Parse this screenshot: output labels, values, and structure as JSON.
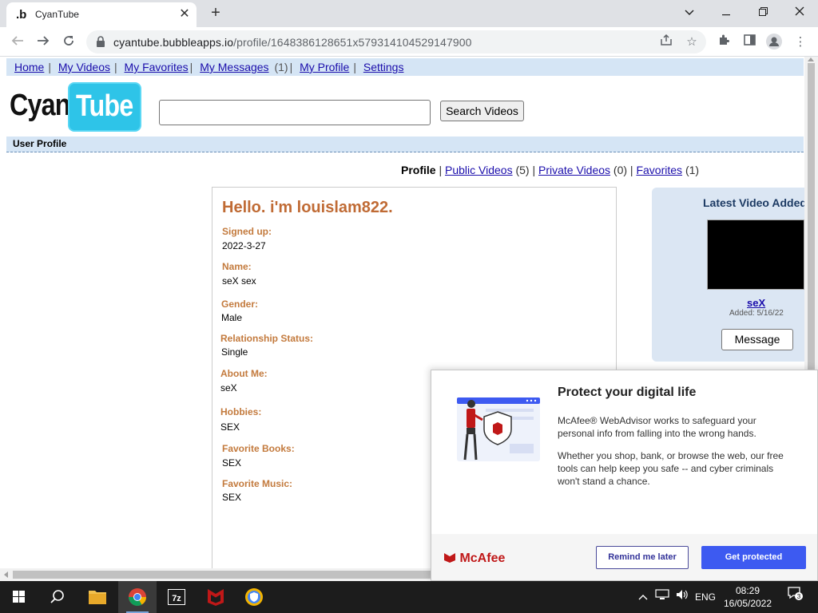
{
  "browser": {
    "tab_title": "CyanTube",
    "tab_favicon": ".b",
    "url_host": "cyantube.bubbleapps.io",
    "url_path": "/profile/1648386128651x579314104529147900"
  },
  "site": {
    "nav": {
      "home": "Home",
      "my_videos": "My Videos",
      "my_favorites": "My Favorites",
      "my_messages": "My Messages",
      "messages_count": "(1)",
      "my_profile": "My Profile",
      "settings": "Settings"
    },
    "logo_left": "Cyan",
    "logo_right": "Tube",
    "search_value": "",
    "search_button": "Search Videos",
    "section_title": "User Profile",
    "profile_tabs": {
      "profile": "Profile",
      "public_videos": "Public Videos",
      "public_count": "(5)",
      "private_videos": "Private Videos",
      "private_count": "(0)",
      "favorites": "Favorites",
      "favorites_count": "(1)"
    },
    "profile": {
      "greeting": "Hello. i'm louislam822.",
      "signed_up_label": "Signed up:",
      "signed_up_value": "2022-3-27",
      "name_label": "Name:",
      "name_value": "seX sex",
      "gender_label": "Gender:",
      "gender_value": "Male",
      "relationship_label": "Relationship Status:",
      "relationship_value": "Single",
      "about_label": "About Me:",
      "about_value": "seX",
      "hobbies_label": "Hobbies:",
      "hobbies_value": "SEX",
      "books_label": "Favorite Books:",
      "books_value": "SEX",
      "music_label": "Favorite Music:",
      "music_value": "SEX"
    },
    "sidebar": {
      "title": "Latest Video Added",
      "video_title": "seX",
      "video_added": "Added: 5/16/22",
      "message_button": "Message"
    }
  },
  "mcafee": {
    "title": "Protect your digital life",
    "p1": "McAfee® WebAdvisor works to safeguard your personal info from falling into the wrong hands.",
    "p2": "Whether you shop, bank, or browse the web, our free tools can help keep you safe -- and cyber criminals won't stand a chance.",
    "logo": "McAfee",
    "remind_button": "Remind me later",
    "protect_button": "Get protected"
  },
  "taskbar": {
    "language": "ENG",
    "time": "08:29",
    "date": "16/05/2022",
    "notification_count": "3"
  },
  "colors": {
    "link": "#1a0dab",
    "label_orange": "#c37a3d",
    "greeting_orange": "#c06b35",
    "nav_bg": "#d5e5f5",
    "logo_cyan": "#2ec4e8",
    "mcafee_red": "#c01818",
    "mcafee_blue": "#3d5af1"
  }
}
